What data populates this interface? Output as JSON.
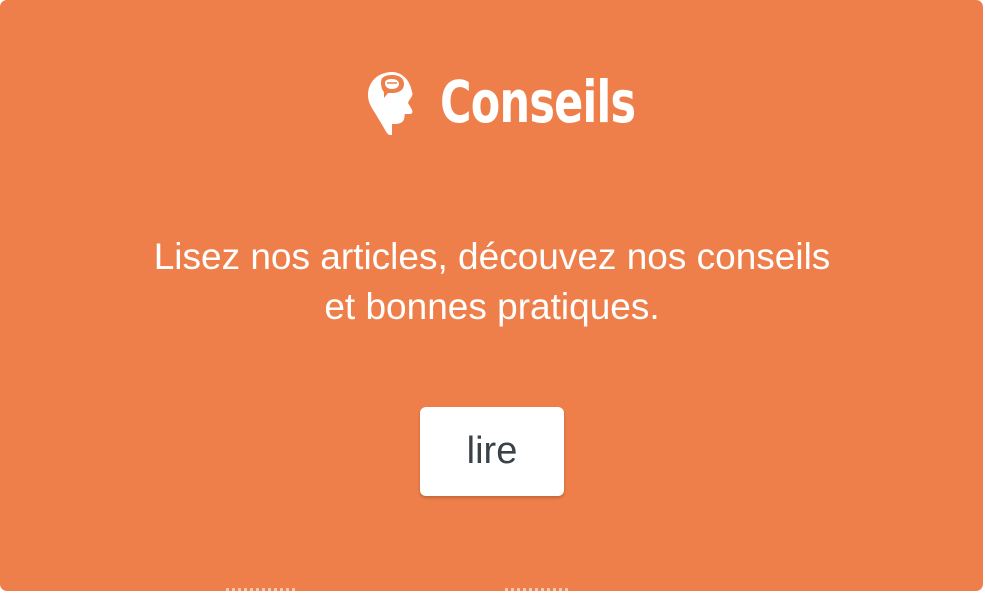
{
  "header": {
    "icon": "head-lightbulb-icon",
    "title": "Conseils"
  },
  "main": {
    "description": "Lisez nos articles, découvez nos conseils et bonnes pratiques."
  },
  "button": {
    "label": "lire"
  },
  "colors": {
    "background": "#ee7f4a",
    "text": "#ffffff",
    "button_background": "#ffffff",
    "button_text": "#3a4248"
  }
}
